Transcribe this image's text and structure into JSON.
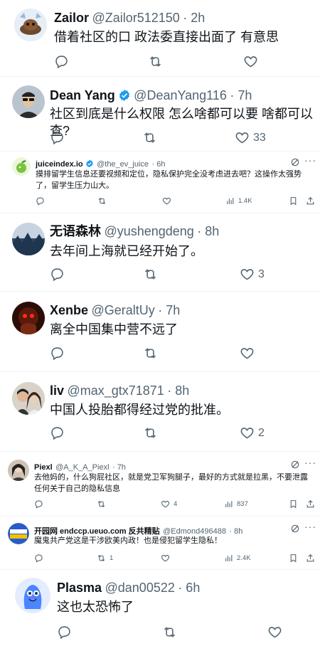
{
  "tweets": [
    {
      "name": "Zailor",
      "handle": "@Zailor512150",
      "time": "· 2h",
      "text": "借着社区的口 政法委直接出面了 有意思",
      "likes": ""
    },
    {
      "name": "Dean Yang",
      "handle": "@DeanYang116",
      "time": "· 7h",
      "text": "社区到底是什么权限 怎么啥都可以要 啥都可以查?",
      "likes": "33"
    },
    {
      "name": "juiceindex.io",
      "handle": "@the_ev_juice",
      "time": "· 6h",
      "text": "摸排留学生信息还要视频和定位，隐私保护完全没考虑进去吧？这操作太强势了，留学生压力山大。",
      "views": "1.4K"
    },
    {
      "name": "无语森林",
      "handle": "@yushengdeng",
      "time": "· 8h",
      "text": "去年间上海就已经开始了。",
      "likes": "3"
    },
    {
      "name": "Xenbe",
      "handle": "@GeraltUy",
      "time": "· 7h",
      "text": "离全中国集中营不远了",
      "likes": ""
    },
    {
      "name": "liv",
      "handle": "@max_gtx71871",
      "time": "· 8h",
      "text": "中国人投胎都得经过党的批准。",
      "likes": "2"
    },
    {
      "name": "Piexl",
      "handle": "@A_K_A_Piexl",
      "time": "· 7h",
      "text": "去他妈的，什么狗屁社区，就是党卫军狗腿子，最好的方式就是拉黑，不要泄露任何关于自己的隐私信息",
      "likes": "4",
      "views": "837"
    },
    {
      "name": "开园网 endccp.ueuo.com 反共精贴",
      "handle": "@Edmond496488",
      "time": "· 8h",
      "text": "魔鬼共产党这是干涉欧美内政！也是侵犯留学生隐私！",
      "retweets": "1",
      "views": "2.4K"
    },
    {
      "name": "Plasma",
      "handle": "@dan00522",
      "time": "· 6h",
      "text": "这也太恐怖了",
      "likes": ""
    }
  ],
  "icons": {
    "reply": "reply-icon",
    "retweet": "retweet-icon",
    "like": "like-icon",
    "views": "views-icon",
    "bookmark": "bookmark-icon",
    "share": "share-icon",
    "grok": "grok-icon",
    "verified": "verified-badge-icon"
  },
  "colors": {
    "text": "#0f1419",
    "muted": "#536471",
    "verified": "#1d9bf0",
    "divider": "#eff3f4"
  }
}
